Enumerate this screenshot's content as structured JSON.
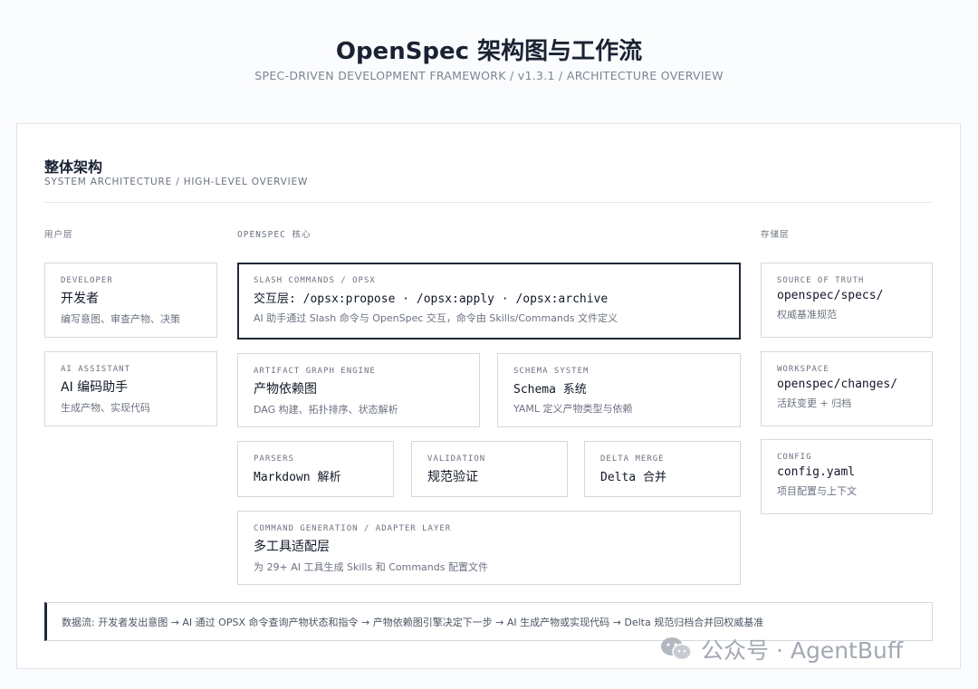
{
  "header": {
    "title": "OpenSpec 架构图与工作流",
    "subtitle": "SPEC-DRIVEN DEVELOPMENT FRAMEWORK / v1.3.1 / ARCHITECTURE OVERVIEW"
  },
  "section": {
    "title": "整体架构",
    "subtitle": "SYSTEM ARCHITECTURE / HIGH-LEVEL OVERVIEW"
  },
  "columns": {
    "user": "用户层",
    "core": "OPENSPEC 核心",
    "storage": "存储层"
  },
  "user_layer": [
    {
      "tag": "DEVELOPER",
      "name": "开发者",
      "desc": "编写意图、审查产物、决策"
    },
    {
      "tag": "AI ASSISTANT",
      "name": "AI 编码助手",
      "desc": "生成产物、实现代码"
    }
  ],
  "core": {
    "slash": {
      "tag": "SLASH COMMANDS / OPSX",
      "name": "交互层: /opsx:propose · /opsx:apply · /opsx:archive",
      "desc": "AI 助手通过 Slash 命令与 OpenSpec 交互，命令由 Skills/Commands 文件定义"
    },
    "artifact": {
      "tag": "ARTIFACT GRAPH ENGINE",
      "name": "产物依赖图",
      "desc": "DAG 构建、拓扑排序、状态解析"
    },
    "schema": {
      "tag": "SCHEMA SYSTEM",
      "name": "Schema 系统",
      "desc": "YAML 定义产物类型与依赖"
    },
    "parsers": {
      "tag": "PARSERS",
      "name": "Markdown 解析"
    },
    "validation": {
      "tag": "VALIDATION",
      "name": "规范验证"
    },
    "delta": {
      "tag": "DELTA MERGE",
      "name": "Delta 合并"
    },
    "generation": {
      "tag": "COMMAND GENERATION / ADAPTER LAYER",
      "name": "多工具适配层",
      "desc": "为 29+ AI 工具生成 Skills 和 Commands 配置文件"
    }
  },
  "storage_layer": [
    {
      "tag": "SOURCE OF TRUTH",
      "name": "openspec/specs/",
      "desc": "权威基准规范"
    },
    {
      "tag": "WORKSPACE",
      "name": "openspec/changes/",
      "desc": "活跃变更 + 归档"
    },
    {
      "tag": "CONFIG",
      "name": "config.yaml",
      "desc": "项目配置与上下文"
    }
  ],
  "flow": "数据流: 开发者发出意图 → AI 通过 OPSX 命令查询产物状态和指令 → 产物依赖图引擎决定下一步 → AI 生成产物或实现代码 → Delta 规范归档合并回权威基准",
  "watermark": "公众号 · AgentBuff",
  "colors": {
    "accent": "#1f2937",
    "border": "#d4d9e0",
    "muted": "#6b7280"
  }
}
